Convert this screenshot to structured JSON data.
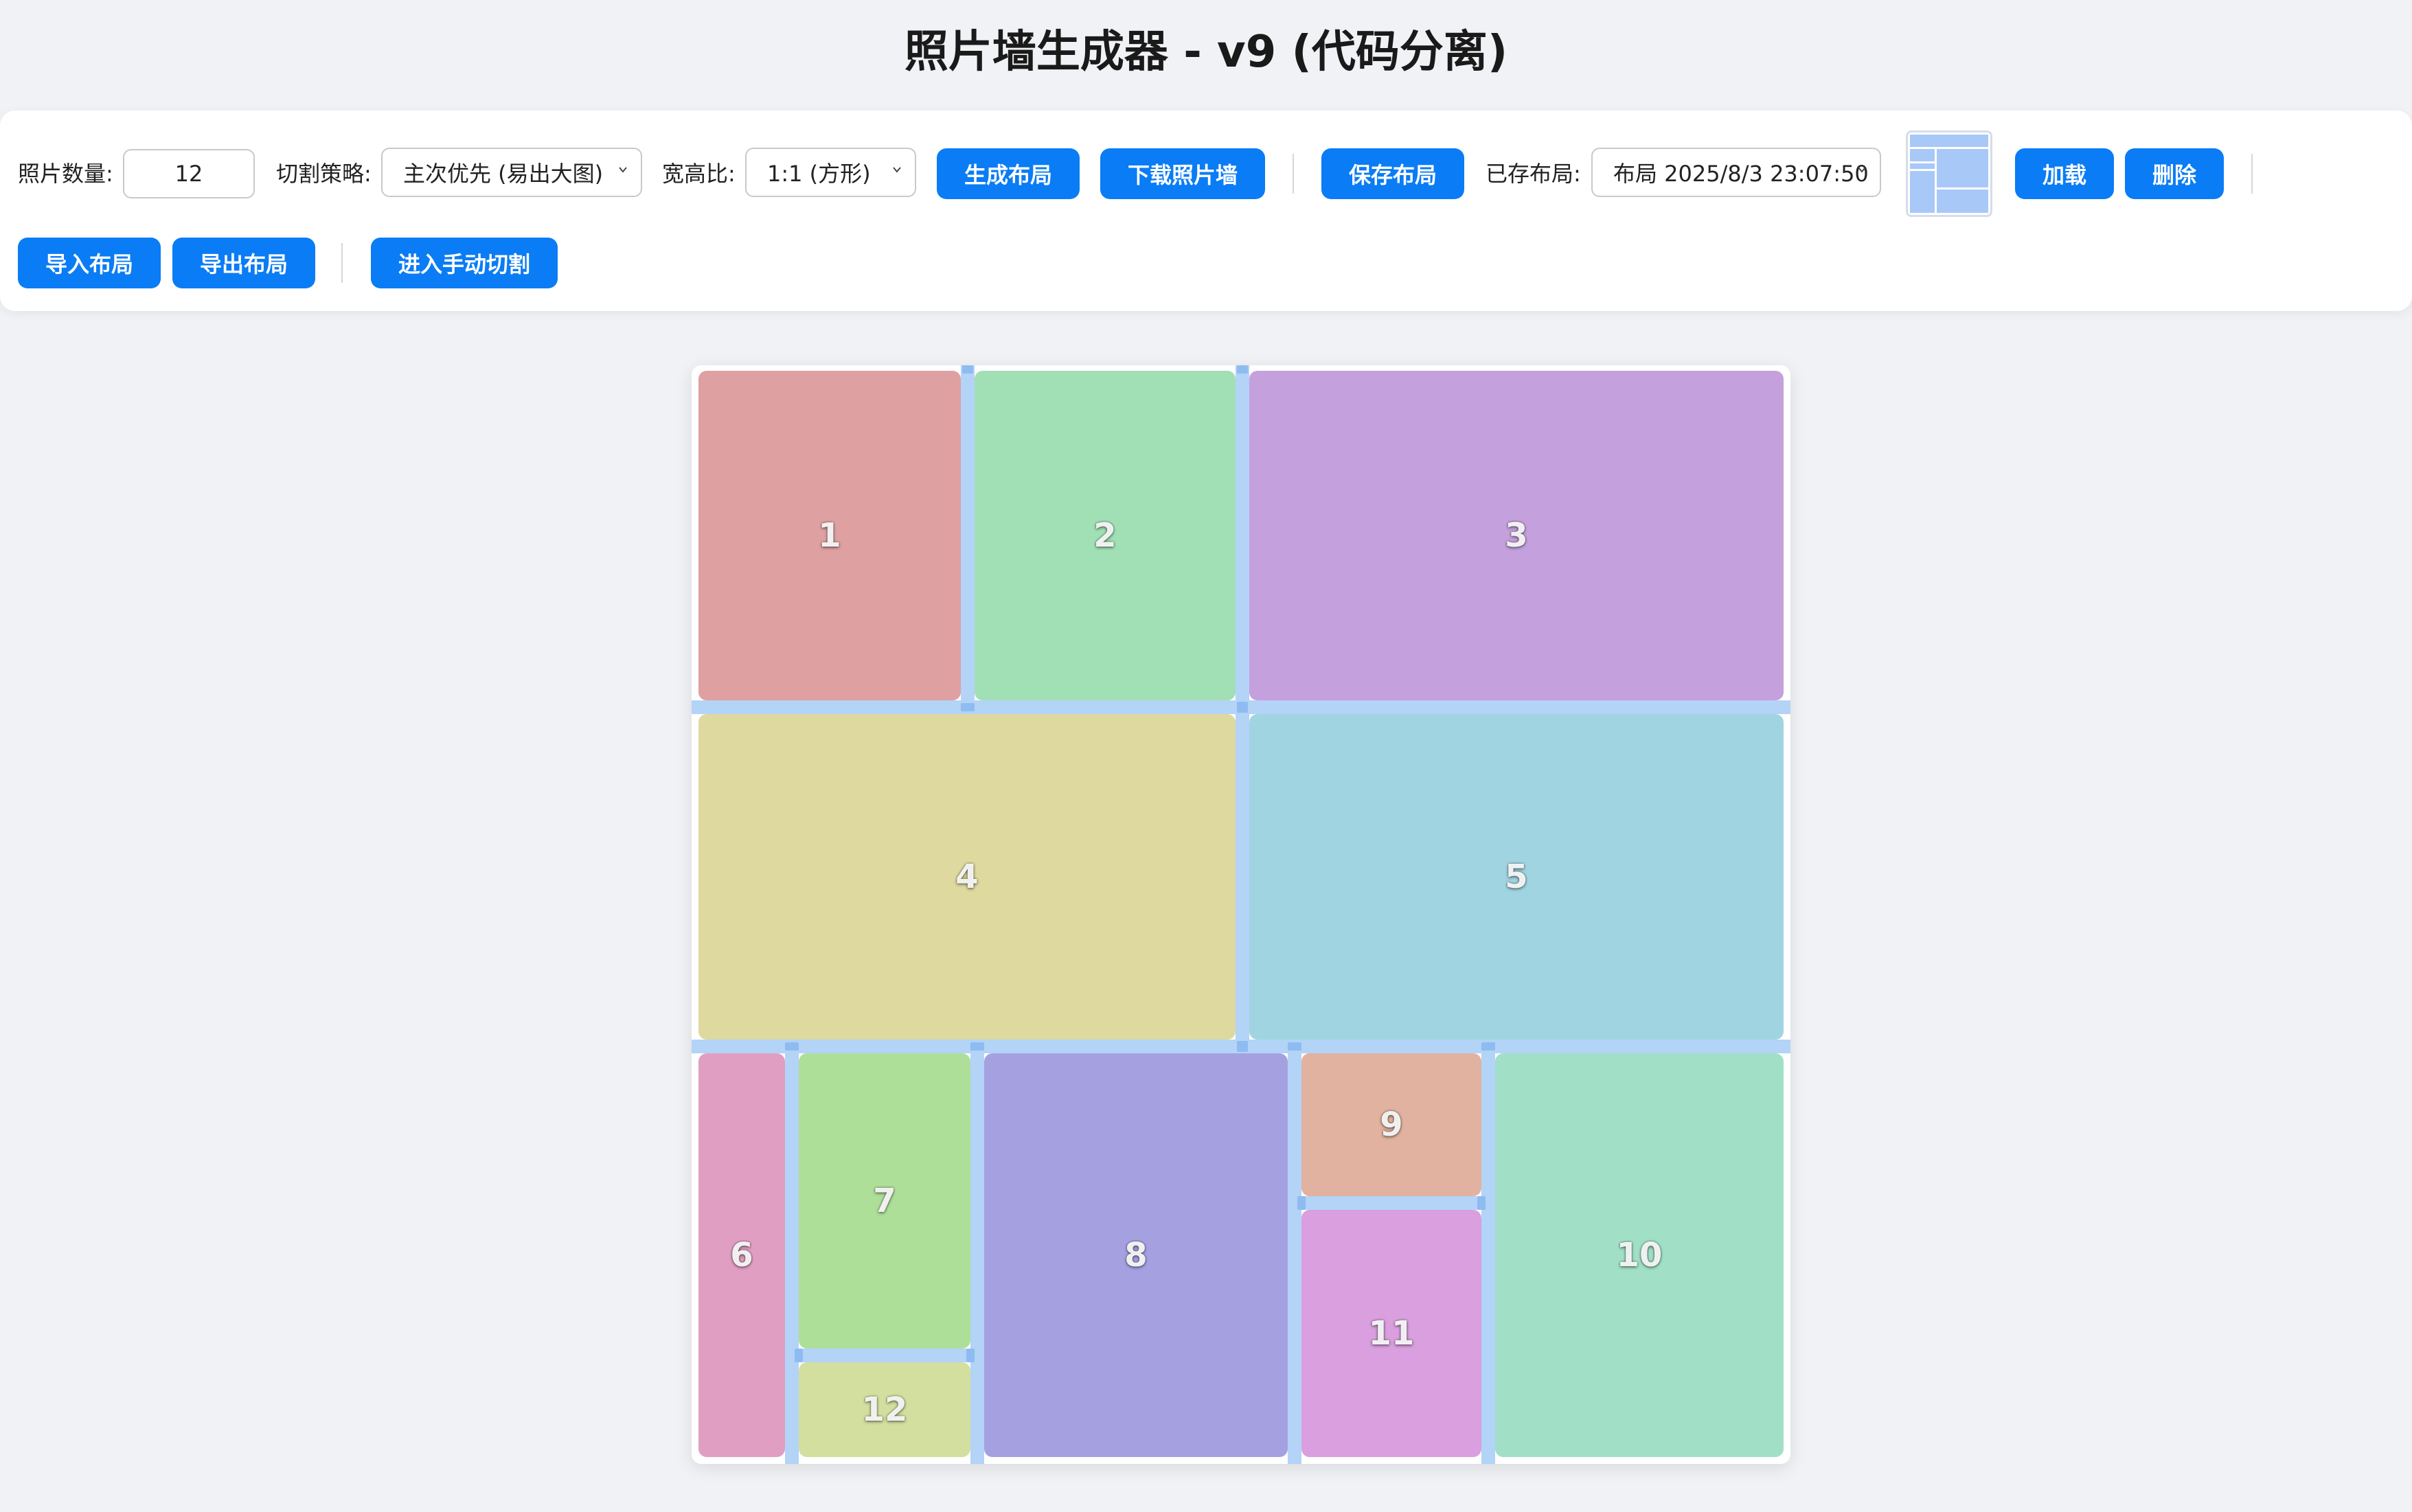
{
  "title": "照片墙生成器 - v9 (代码分离)",
  "toolbar": {
    "count_label": "照片数量:",
    "count_value": "12",
    "strategy_label": "切割策略:",
    "strategy_value": "主次优先 (易出大图)",
    "ratio_label": "宽高比:",
    "ratio_value": "1:1 (方形)",
    "generate_label": "生成布局",
    "download_label": "下载照片墙",
    "save_label": "保存布局",
    "saved_label": "已存布局:",
    "saved_value": "布局 2025/8/3 23:07:50",
    "load_label": "加载",
    "delete_label": "删除",
    "import_label": "导入布局",
    "export_label": "导出布局",
    "manual_label": "进入手动切割"
  },
  "colors": {
    "button": "#0a7cf5",
    "gutter": "#b3d3f7"
  },
  "tiles": [
    {
      "label": "1",
      "color": "#dfa0a1"
    },
    {
      "label": "2",
      "color": "#a1dfb4"
    },
    {
      "label": "3",
      "color": "#c4a0dc"
    },
    {
      "label": "4",
      "color": "#ded99f"
    },
    {
      "label": "5",
      "color": "#a1d4e1"
    },
    {
      "label": "6",
      "color": "#e09fc2"
    },
    {
      "label": "7",
      "color": "#aedf99"
    },
    {
      "label": "8",
      "color": "#a5a1e0"
    },
    {
      "label": "9",
      "color": "#e0b29f"
    },
    {
      "label": "10",
      "color": "#a1e0c7"
    },
    {
      "label": "11",
      "color": "#d99fdf"
    },
    {
      "label": "12",
      "color": "#d3df9f"
    }
  ]
}
